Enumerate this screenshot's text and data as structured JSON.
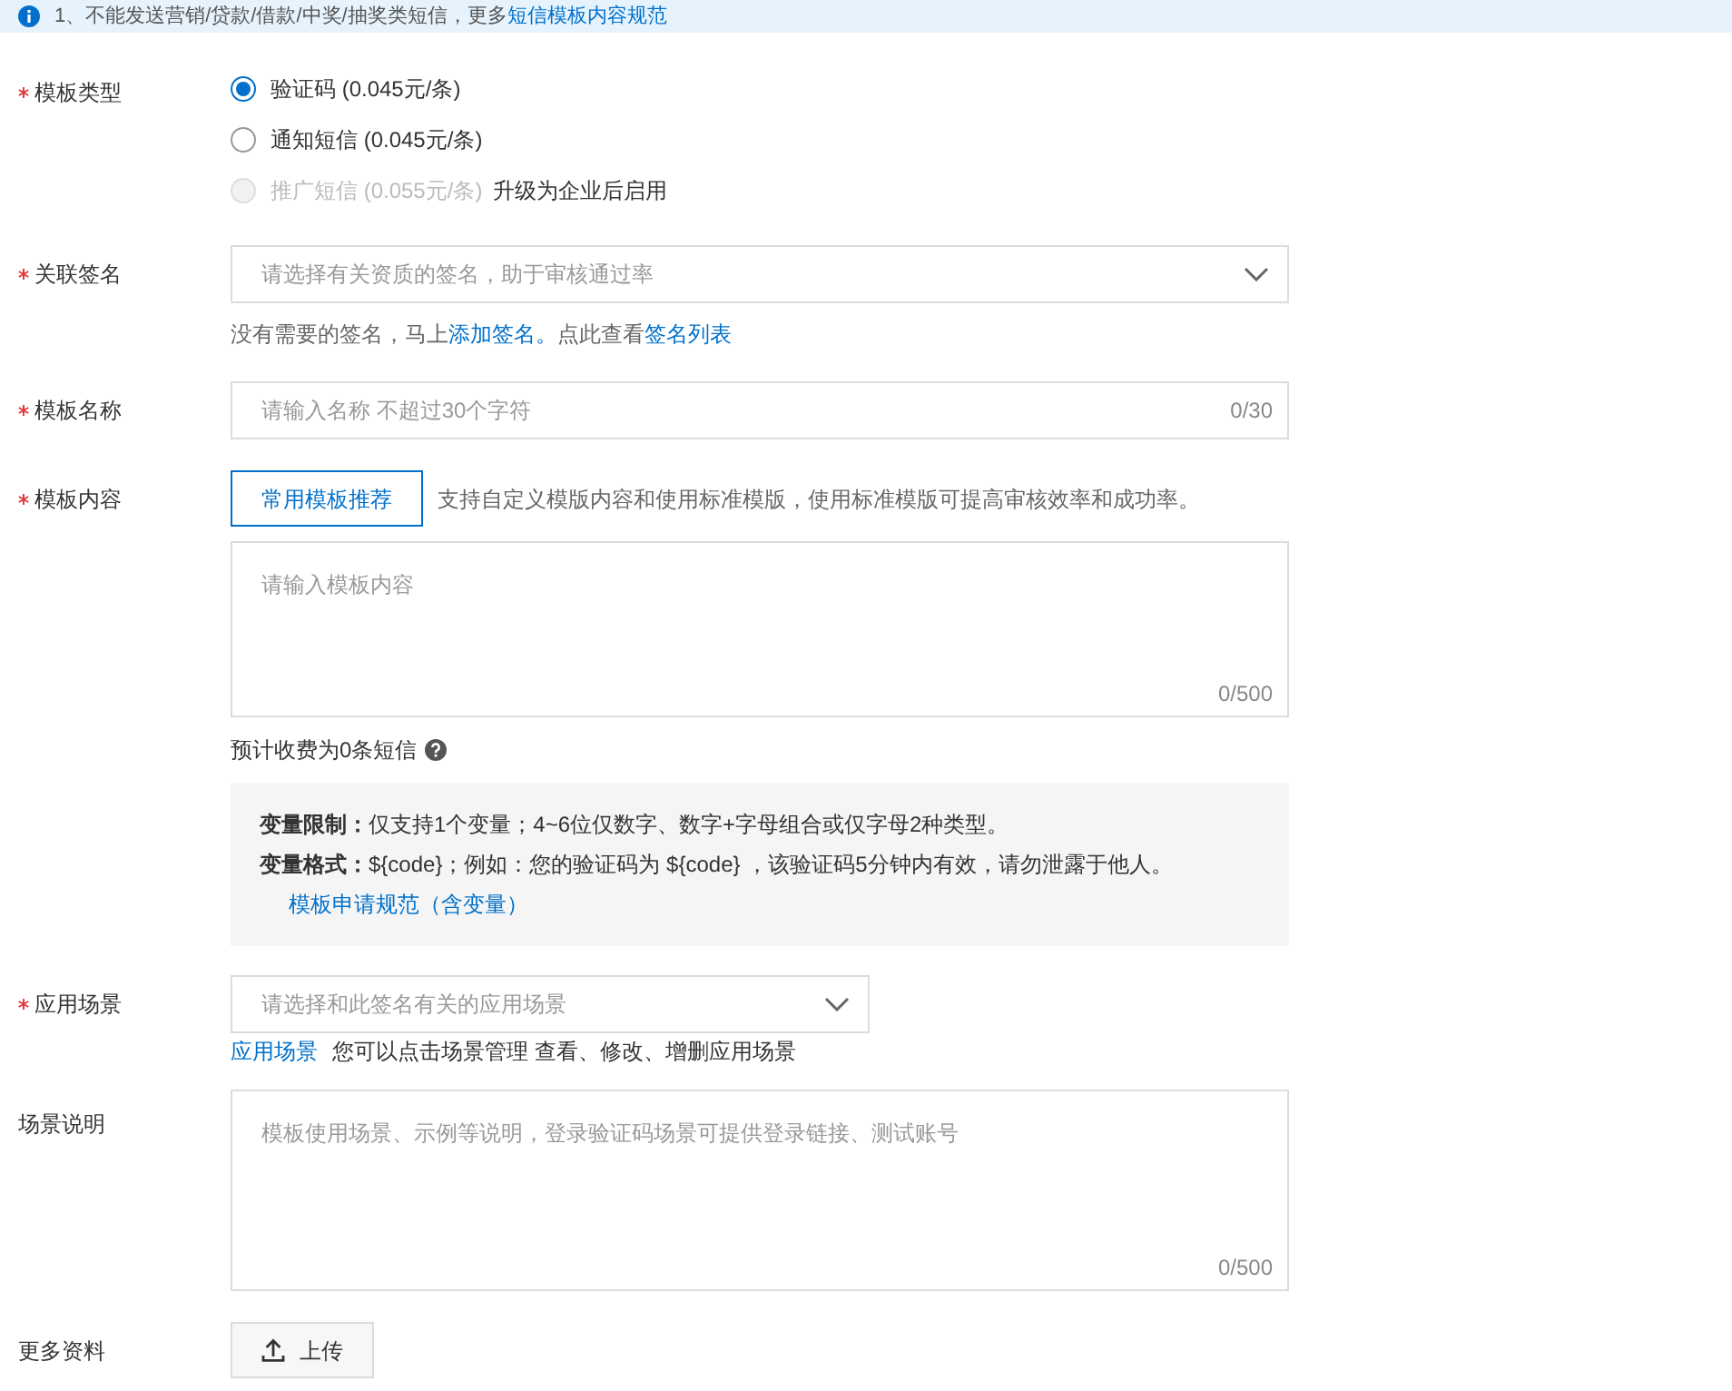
{
  "notice": {
    "text": "1、不能发送营销/贷款/借款/中奖/抽奖类短信，更多",
    "link": "短信模板内容规范"
  },
  "template_type": {
    "label": "模板类型",
    "required": true,
    "options": [
      {
        "label": "验证码 (0.045元/条)",
        "selected": true,
        "disabled": false
      },
      {
        "label": "通知短信 (0.045元/条)",
        "selected": false,
        "disabled": false
      },
      {
        "label": "推广短信 (0.055元/条)",
        "selected": false,
        "disabled": true,
        "note": "升级为企业后启用"
      }
    ]
  },
  "signature": {
    "label": "关联签名",
    "required": true,
    "placeholder": "请选择有关资质的签名，助于审核通过率",
    "help": [
      {
        "text": "没有需要的签名，马上",
        "link": false
      },
      {
        "text": "添加签名。",
        "link": true
      },
      {
        "text": "点此查看",
        "link": false
      },
      {
        "text": "签名列表",
        "link": true
      }
    ]
  },
  "name": {
    "label": "模板名称",
    "required": true,
    "placeholder": "请输入名称 不超过30个字符",
    "counter": "0/30"
  },
  "content": {
    "label": "模板内容",
    "required": true,
    "button": "常用模板推荐",
    "hint": "支持自定义模版内容和使用标准模版，使用标准模版可提高审核效率和成功率。",
    "placeholder": "请输入模板内容",
    "counter": "0/500",
    "fee": "预计收费为0条短信",
    "rules": [
      "**变量限制：**仅支持1个变量；4~6位仅数字、数字+字母组合或仅字母2种类型。",
      "**变量格式：**${code}；例如：您的验证码为 ${code} ，该验证码5分钟内有效，请勿泄露于他人。"
    ],
    "rules_link": "模板申请规范（含变量）"
  },
  "scene": {
    "label": "应用场景",
    "required": true,
    "placeholder": "请选择和此签名有关的应用场景",
    "link": "应用场景",
    "hint": "您可以点击场景管理 查看、修改、增删应用场景"
  },
  "description": {
    "label": "场景说明",
    "required": false,
    "placeholder": "模板使用场景、示例等说明，登录验证码场景可提供登录链接、测试账号",
    "counter": "0/500"
  },
  "attachments": {
    "label": "更多资料",
    "required": false,
    "button": "上传"
  }
}
